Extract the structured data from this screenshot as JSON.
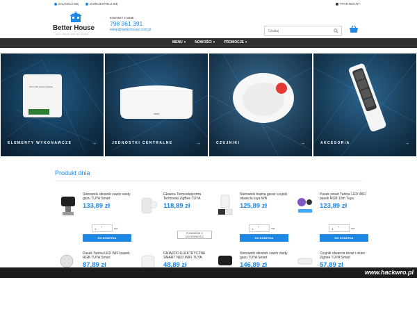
{
  "topbar": {
    "login": "ZALOGUJ SIĘ",
    "register": "ZAREJESTRUJ SIĘ",
    "night_mode": "TRYB NOCNY"
  },
  "logo": {
    "name": "Better House",
    "tagline": "your future will be better"
  },
  "contact": {
    "label": "KONTAKT Z NAMI",
    "phone": "798 361 391",
    "email": "sklep@betterhouse.com.pl"
  },
  "search": {
    "placeholder": "Szukaj"
  },
  "cart": {
    "label": "0 (pusty)"
  },
  "nav": {
    "items": [
      "MENU",
      "NOWOŚCI",
      "PROMOCJE"
    ]
  },
  "hero": {
    "tiles": [
      {
        "caption": "ELEMENTY WYKONAWCZE",
        "label_on_device": "Wi-Fi+RF Curtain Module"
      },
      {
        "caption": "JEDNOSTKI CENTRALNE"
      },
      {
        "caption": "CZUJNIKI"
      },
      {
        "caption": "AKCESORIA"
      }
    ],
    "arrow_icon": "arrow-right-icon"
  },
  "section": {
    "title": "Produkt dnia"
  },
  "products": [
    {
      "name": "Sterownik siłownik zawór wody gazu TUYA Smart",
      "price": "133,89 zł",
      "qty": "1",
      "unit": "szt.",
      "button": "DO KOSZYKA"
    },
    {
      "name": "Głowica Termostatyczna Termostat ZigBee TUYA",
      "price": "118,89 zł",
      "notify": "POWIADOM O DOSTĘPNOŚCI"
    },
    {
      "name": "Sterownik brama garaż czujnik otwarcia tuya Wifi",
      "price": "125,89 zł",
      "qty": "1",
      "unit": "szt.",
      "button": "DO KOSZYKA"
    },
    {
      "name": "Pasek smart Taśma LED WIFI pasek RGB 10m Tuya",
      "price": "123,89 zł",
      "qty": "1",
      "unit": "szt.",
      "button": "DO KOSZYKA"
    },
    {
      "name": "Pasek Taśma LED WIFI pasek RGB TUYA Smart",
      "price": "87,89 zł"
    },
    {
      "name": "GNIAZDO ELEKTRYCZNE SMART NEO WIFI TUYA",
      "price": "48,89 zł"
    },
    {
      "name": "Sterownik siłownik zawór wody gazu TUYA Smart",
      "price": "146,89 zł"
    },
    {
      "name": "Czujnik otwarcia drzwi i okien Zigbee TUYA Smart",
      "price": "57,89 zł"
    }
  ],
  "watermark": "www.hackwro.pl",
  "colors": {
    "accent": "#1e88e5",
    "nav_bg": "#2f2f2f",
    "hero_bg": "#0f2a3e"
  }
}
